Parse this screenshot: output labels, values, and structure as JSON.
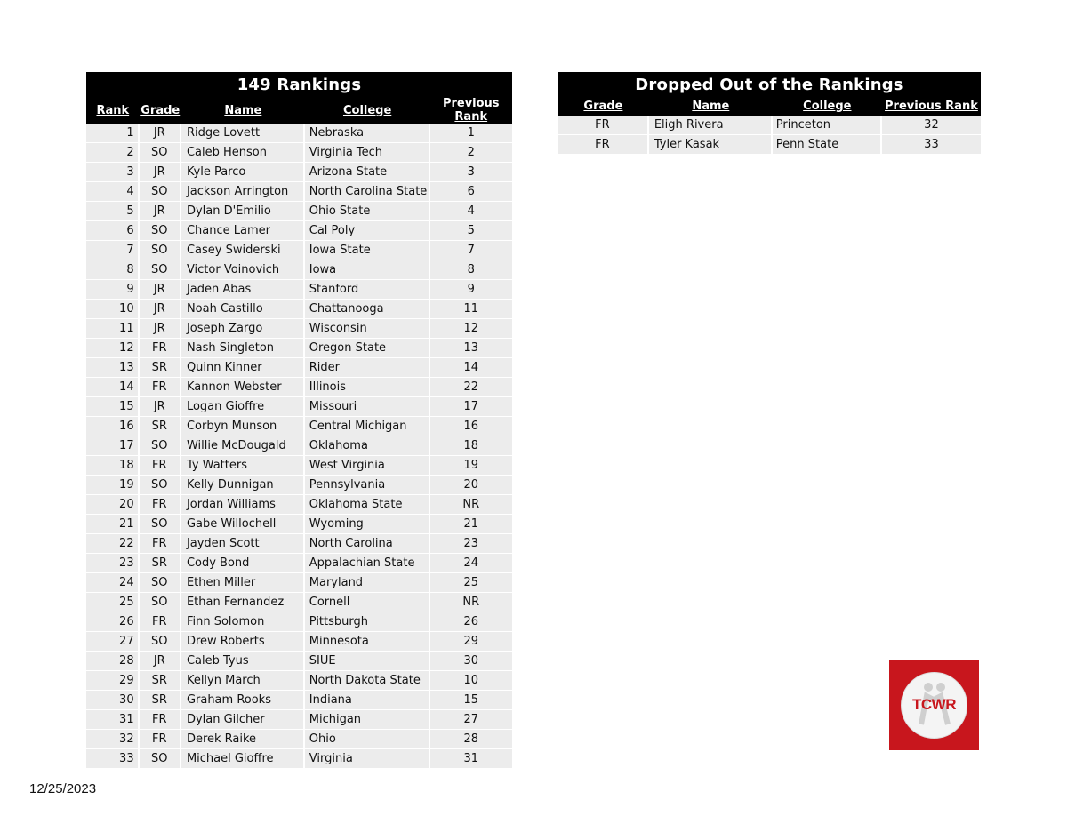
{
  "rankings": {
    "title": "149 Rankings",
    "headers": [
      "Rank",
      "Grade",
      "Name",
      "College",
      "Previous Rank"
    ],
    "rows": [
      [
        "1",
        "JR",
        "Ridge Lovett",
        "Nebraska",
        "1"
      ],
      [
        "2",
        "SO",
        "Caleb Henson",
        "Virginia Tech",
        "2"
      ],
      [
        "3",
        "JR",
        "Kyle Parco",
        "Arizona State",
        "3"
      ],
      [
        "4",
        "SO",
        "Jackson Arrington",
        "North Carolina State",
        "6"
      ],
      [
        "5",
        "JR",
        "Dylan D'Emilio",
        "Ohio State",
        "4"
      ],
      [
        "6",
        "SO",
        "Chance Lamer",
        "Cal Poly",
        "5"
      ],
      [
        "7",
        "SO",
        "Casey Swiderski",
        "Iowa State",
        "7"
      ],
      [
        "8",
        "SO",
        "Victor Voinovich",
        "Iowa",
        "8"
      ],
      [
        "9",
        "JR",
        "Jaden Abas",
        "Stanford",
        "9"
      ],
      [
        "10",
        "JR",
        "Noah Castillo",
        "Chattanooga",
        "11"
      ],
      [
        "11",
        "JR",
        "Joseph Zargo",
        "Wisconsin",
        "12"
      ],
      [
        "12",
        "FR",
        "Nash Singleton",
        "Oregon State",
        "13"
      ],
      [
        "13",
        "SR",
        "Quinn Kinner",
        "Rider",
        "14"
      ],
      [
        "14",
        "FR",
        "Kannon Webster",
        "Illinois",
        "22"
      ],
      [
        "15",
        "JR",
        "Logan Gioffre",
        "Missouri",
        "17"
      ],
      [
        "16",
        "SR",
        "Corbyn Munson",
        "Central Michigan",
        "16"
      ],
      [
        "17",
        "SO",
        "Willie McDougald",
        "Oklahoma",
        "18"
      ],
      [
        "18",
        "FR",
        "Ty Watters",
        "West Virginia",
        "19"
      ],
      [
        "19",
        "SO",
        "Kelly Dunnigan",
        "Pennsylvania",
        "20"
      ],
      [
        "20",
        "FR",
        "Jordan Williams",
        "Oklahoma State",
        "NR"
      ],
      [
        "21",
        "SO",
        "Gabe Willochell",
        "Wyoming",
        "21"
      ],
      [
        "22",
        "FR",
        "Jayden Scott",
        "North Carolina",
        "23"
      ],
      [
        "23",
        "SR",
        "Cody Bond",
        "Appalachian State",
        "24"
      ],
      [
        "24",
        "SO",
        "Ethen Miller",
        "Maryland",
        "25"
      ],
      [
        "25",
        "SO",
        "Ethan Fernandez",
        "Cornell",
        "NR"
      ],
      [
        "26",
        "FR",
        "Finn Solomon",
        "Pittsburgh",
        "26"
      ],
      [
        "27",
        "SO",
        "Drew Roberts",
        "Minnesota",
        "29"
      ],
      [
        "28",
        "JR",
        "Caleb Tyus",
        "SIUE",
        "30"
      ],
      [
        "29",
        "SR",
        "Kellyn March",
        "North Dakota State",
        "10"
      ],
      [
        "30",
        "SR",
        "Graham Rooks",
        "Indiana",
        "15"
      ],
      [
        "31",
        "FR",
        "Dylan Gilcher",
        "Michigan",
        "27"
      ],
      [
        "32",
        "FR",
        "Derek Raike",
        "Ohio",
        "28"
      ],
      [
        "33",
        "SO",
        "Michael Gioffre",
        "Virginia",
        "31"
      ]
    ]
  },
  "dropped": {
    "title": "Dropped Out of the Rankings",
    "headers": [
      "Grade",
      "Name",
      "College",
      "Previous Rank"
    ],
    "rows": [
      [
        "FR",
        "Eligh Rivera",
        "Princeton",
        "32"
      ],
      [
        "FR",
        "Tyler Kasak",
        "Penn State",
        "33"
      ]
    ]
  },
  "logo": {
    "text": "TCWR",
    "icon": "tcwr-logo-icon",
    "color": "#c8161d"
  },
  "footer": {
    "date": "12/25/2023"
  }
}
